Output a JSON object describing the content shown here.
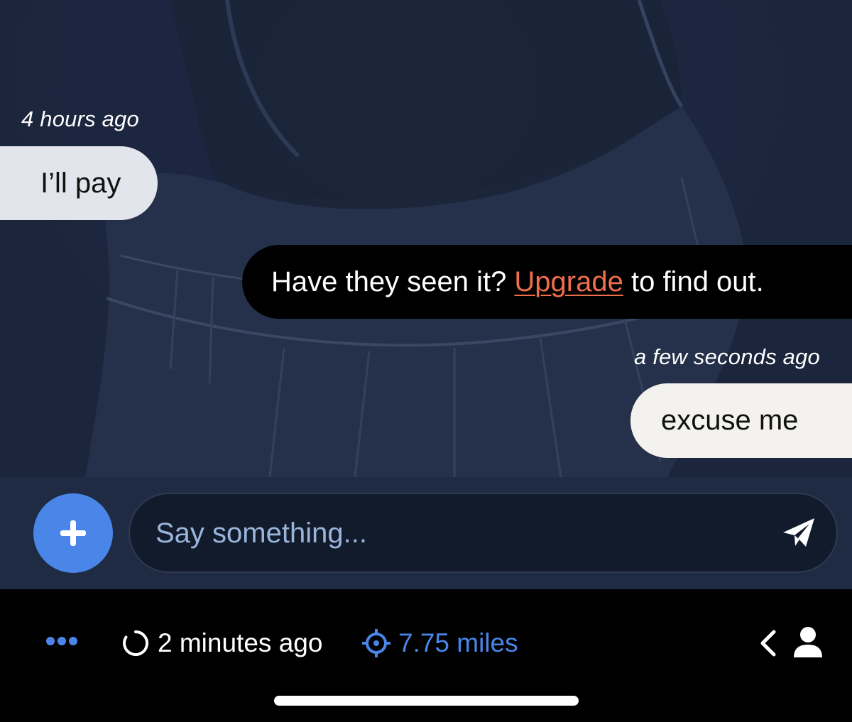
{
  "messages": [
    {
      "timestamp": "4 hours ago",
      "text": "I’ll pay",
      "direction": "incoming"
    },
    {
      "system_prefix": "Have they seen it? ",
      "system_link": "Upgrade",
      "system_suffix": " to find out."
    },
    {
      "timestamp": "a few seconds ago",
      "text": "excuse me",
      "direction": "outgoing"
    }
  ],
  "composer": {
    "placeholder": "Say something...",
    "value": ""
  },
  "status_bar": {
    "last_active": "2 minutes ago",
    "distance": "7.75 miles"
  },
  "icons": {
    "add": "plus-icon",
    "send": "paper-plane-icon",
    "more": "ellipsis-icon",
    "last_active": "circle-loading-icon",
    "distance": "crosshair-location-icon",
    "back": "chevron-left-icon",
    "profile": "person-icon"
  },
  "colors": {
    "accent": "#4a86e8",
    "upgrade_link": "#ee6e4e",
    "incoming_bubble": "#e3e5ec",
    "outgoing_bubble": "#f3f2ef",
    "system_bubble": "#000000"
  }
}
